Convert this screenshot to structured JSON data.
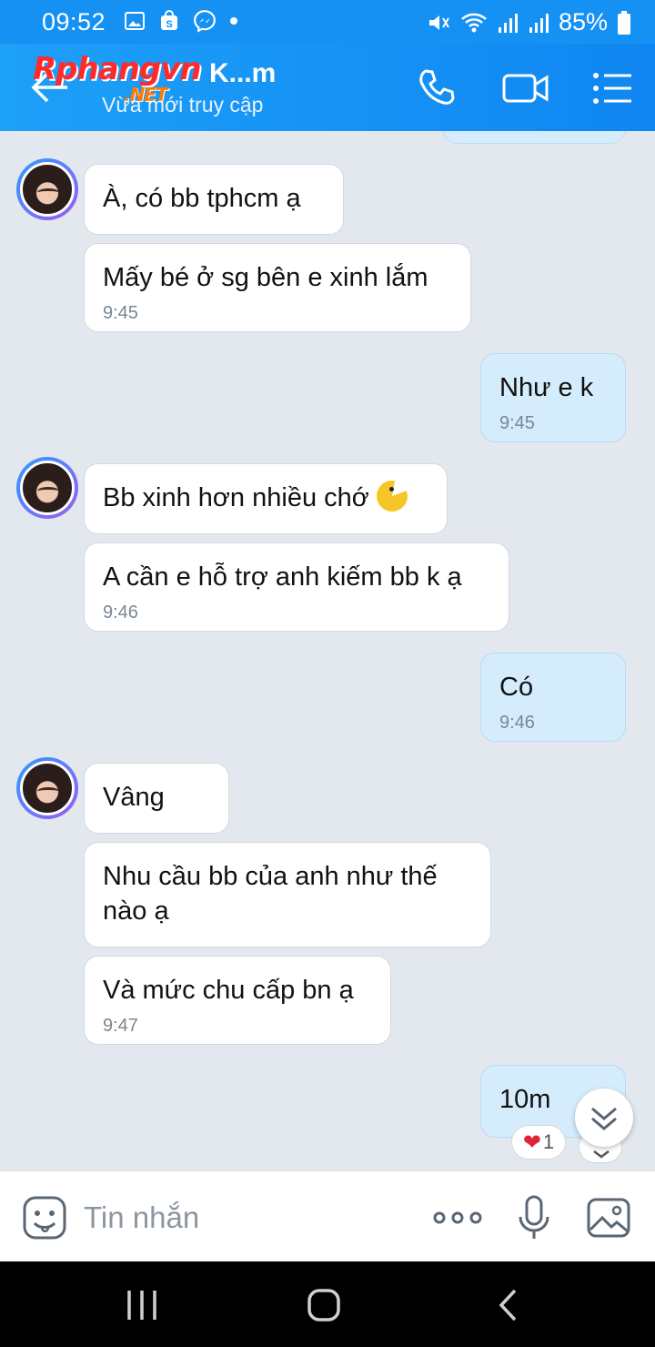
{
  "status_bar": {
    "time": "09:52",
    "battery": "85%"
  },
  "header": {
    "logo_text": "Rphangvn",
    "logo_sub": ".NET",
    "contact_name": "K...m",
    "contact_status": "Vừa mới truy cập"
  },
  "messages": [
    {
      "dir": "in",
      "text": "À,  có bb tphcm ạ",
      "time": ""
    },
    {
      "dir": "in",
      "text": "Mấy bé ở sg bên e xinh lắm",
      "time": "9:45"
    },
    {
      "dir": "out",
      "text": "Như e k",
      "time": "9:45"
    },
    {
      "dir": "in",
      "text": "Bb xinh hơn nhiều chớ",
      "time": ""
    },
    {
      "dir": "in",
      "text": "A cần e hỗ trợ anh kiếm bb k ạ",
      "time": "9:46"
    },
    {
      "dir": "out",
      "text": "Có",
      "time": "9:46"
    },
    {
      "dir": "in",
      "text": "Vâng",
      "time": ""
    },
    {
      "dir": "in",
      "text": "Nhu cầu bb của anh như thế nào ạ",
      "time": ""
    },
    {
      "dir": "in",
      "text": "Và mức chu cấp bn ạ",
      "time": "9:47"
    },
    {
      "dir": "out",
      "text": "10m",
      "time": ""
    }
  ],
  "reaction": {
    "count": "1"
  },
  "input": {
    "placeholder": "Tin nhắn"
  },
  "colors": {
    "header": "#1591f4",
    "bubble_out": "#d5ecfc",
    "bubble_in": "#ffffff",
    "chat_bg": "#e3e8ee"
  }
}
